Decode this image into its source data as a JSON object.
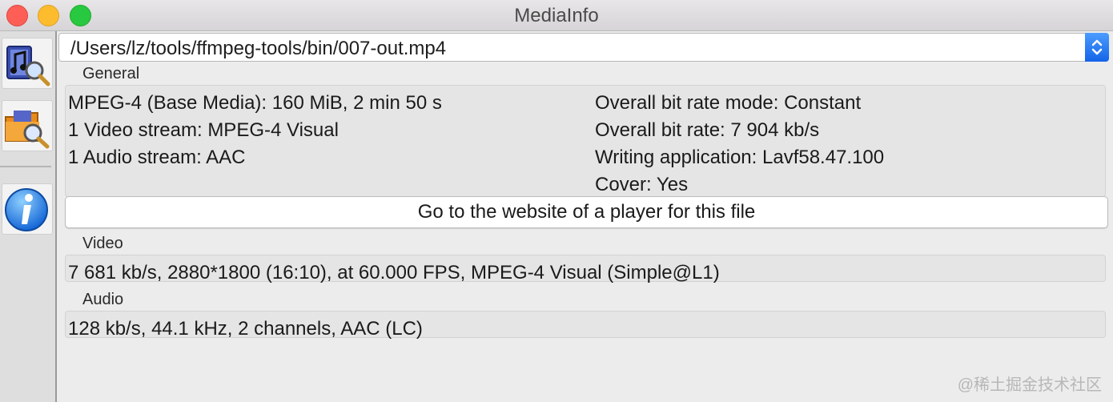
{
  "window": {
    "title": "MediaInfo"
  },
  "sidebar": {
    "buttons": [
      {
        "icon": "music-file-search-icon"
      },
      {
        "icon": "folder-search-icon"
      },
      {
        "icon": "info-icon"
      }
    ]
  },
  "file": {
    "path": "/Users/lz/tools/ffmpeg-tools/bin/007-out.mp4"
  },
  "general": {
    "label": "General",
    "left": [
      "MPEG-4 (Base Media): 160 MiB, 2 min 50 s",
      "1 Video stream: MPEG-4 Visual",
      "1 Audio stream: AAC"
    ],
    "right": [
      "Overall bit rate mode: Constant",
      "Overall bit rate: 7 904 kb/s",
      "Writing application: Lavf58.47.100",
      "Cover: Yes"
    ],
    "player_button": "Go to the website of a player for this file"
  },
  "video": {
    "label": "Video",
    "summary": "7 681 kb/s, 2880*1800 (16:10), at 60.000 FPS, MPEG-4 Visual (Simple@L1)"
  },
  "audio": {
    "label": "Audio",
    "summary": "128 kb/s, 44.1 kHz, 2 channels, AAC (LC)"
  },
  "watermark": "@稀土掘金技术社区",
  "colors": {
    "accent": "#1464e8",
    "close": "#fd5f57",
    "minimize": "#fdbc2e",
    "maximize": "#28c840"
  }
}
